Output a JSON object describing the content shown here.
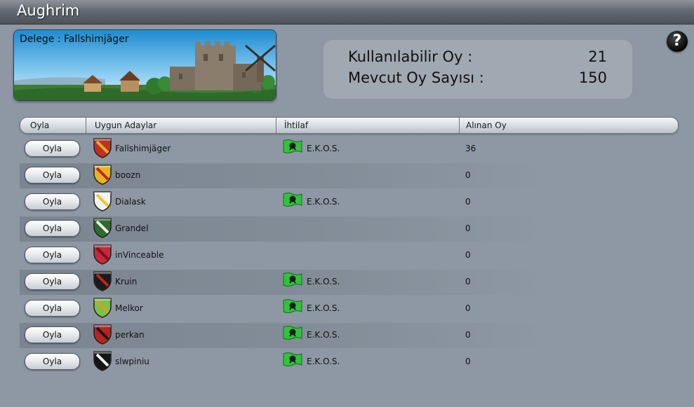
{
  "window": {
    "title": "Aughrim"
  },
  "banner": {
    "delegate_label": "Delege : Fallshimjäger"
  },
  "vote_summary": {
    "available_label": "Kullanılabilir Oy :",
    "available_value": "21",
    "total_label": "Mevcut Oy Sayısı :",
    "total_value": "150"
  },
  "help": {
    "label": "?"
  },
  "table": {
    "headers": [
      "Oyla",
      "Uygun Adaylar",
      "İhtilaf",
      "Alınan Oy"
    ],
    "rows": [
      {
        "button": "Oyla",
        "name": "Fallshimjäger",
        "clan": "E.K.O.S.",
        "votes": "36",
        "shield": "shield-icon-red-gold",
        "has_clan": true
      },
      {
        "button": "Oyla",
        "name": "boozn",
        "clan": "",
        "votes": "0",
        "shield": "shield-icon-gold-dots",
        "has_clan": false
      },
      {
        "button": "Oyla",
        "name": "Dialask",
        "clan": "E.K.O.S.",
        "votes": "0",
        "shield": "shield-icon-white-yellow",
        "has_clan": true
      },
      {
        "button": "Oyla",
        "name": "Grandel",
        "clan": "",
        "votes": "0",
        "shield": "shield-icon-green-white",
        "has_clan": false
      },
      {
        "button": "Oyla",
        "name": "inVinceable",
        "clan": "",
        "votes": "0",
        "shield": "shield-icon-red",
        "has_clan": false
      },
      {
        "button": "Oyla",
        "name": "Kruin",
        "clan": "E.K.O.S.",
        "votes": "0",
        "shield": "shield-icon-black-red",
        "has_clan": true
      },
      {
        "button": "Oyla",
        "name": "Melkor",
        "clan": "E.K.O.S.",
        "votes": "0",
        "shield": "shield-icon-green-bird",
        "has_clan": true
      },
      {
        "button": "Oyla",
        "name": "perkan",
        "clan": "E.K.O.S.",
        "votes": "0",
        "shield": "shield-icon-red-cross",
        "has_clan": true
      },
      {
        "button": "Oyla",
        "name": "slwpiniu",
        "clan": "E.K.O.S.",
        "votes": "0",
        "shield": "shield-icon-black-star",
        "has_clan": true
      }
    ]
  },
  "colors": {
    "background": "#8e98a4",
    "alt_row": "#7b8591",
    "clan_flag": "#2fc43a"
  }
}
